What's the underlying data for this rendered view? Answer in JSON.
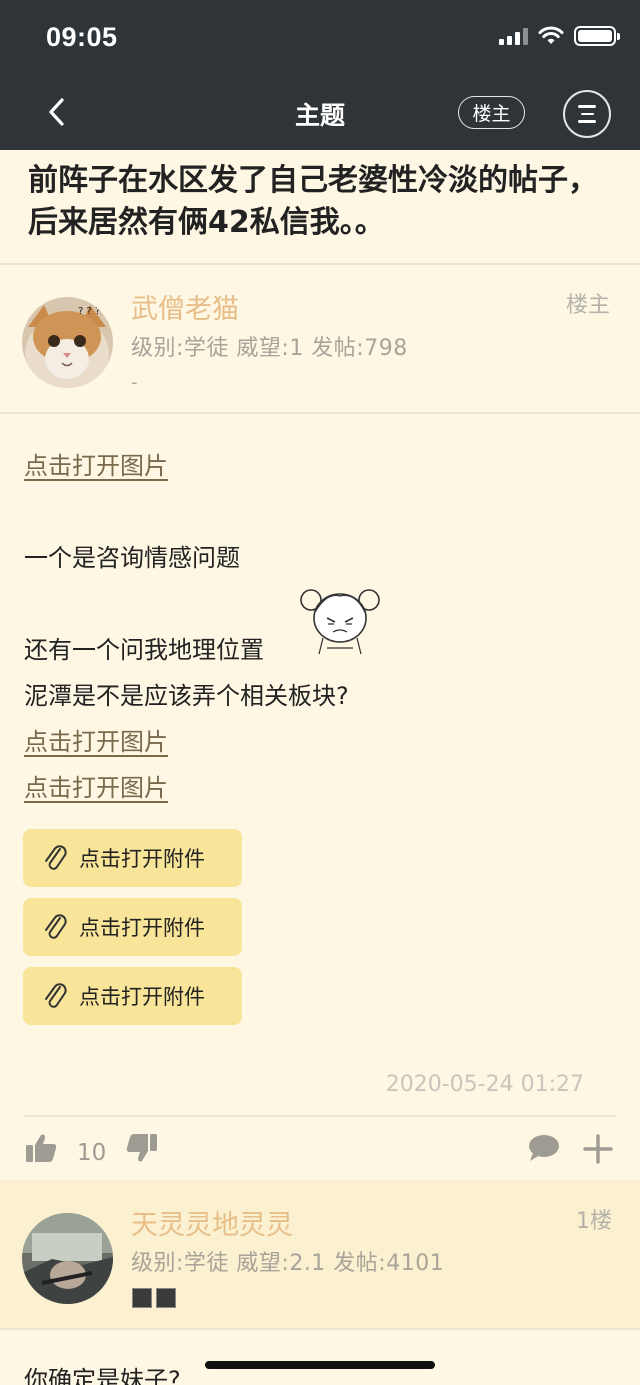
{
  "status": {
    "time": "09:05"
  },
  "nav": {
    "title": "主题",
    "op_label": "楼主"
  },
  "thread": {
    "title": "前阵子在水区发了自己老婆性冷淡的帖子，后来居然有俩42私信我。。"
  },
  "op_post": {
    "author": "武僧老猫",
    "meta": "级别:学徒  威望:1  发帖:798",
    "meta_extra": "-",
    "floor": "楼主",
    "image_link_1": "点击打开图片",
    "line_1": "一个是咨询情感问题",
    "line_2": "还有一个问我地理位置",
    "line_3": "泥潭是不是应该弄个相关板块?",
    "image_link_2": "点击打开图片",
    "image_link_3": "点击打开图片",
    "attachments": [
      "点击打开附件",
      "点击打开附件",
      "点击打开附件"
    ],
    "date": "2020-05-24 01:27",
    "likes": "10"
  },
  "reply_1": {
    "author": "天灵灵地灵灵",
    "meta": "级别:学徒  威望:2.1  发帖:4101",
    "floor": "1楼",
    "text": "你确定是妹子?"
  },
  "colors": {
    "topbar": "#2f3438",
    "background": "#fdf7e4",
    "author_name": "#e8be88",
    "attachment_bg": "#f8e59a"
  }
}
